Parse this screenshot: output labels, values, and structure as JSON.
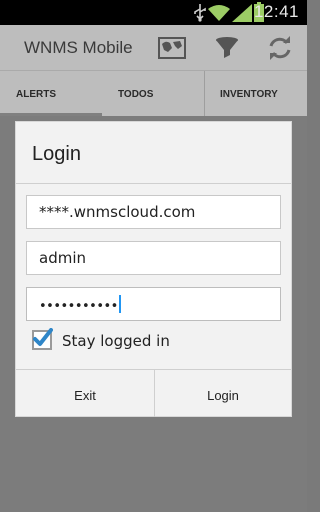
{
  "status_bar": {
    "time": "12:41",
    "icons": [
      "usb-icon",
      "wifi-icon",
      "signal-icon",
      "battery-icon"
    ]
  },
  "action_bar": {
    "title": "WNMS Mobile",
    "buttons": [
      "map-icon",
      "filter-icon",
      "refresh-icon"
    ]
  },
  "tabs": [
    {
      "label": "ALERTS",
      "selected": true
    },
    {
      "label": "TODOS",
      "selected": false
    },
    {
      "label": "INVENTORY",
      "selected": false
    }
  ],
  "login_dialog": {
    "title": "Login",
    "server_value": "****.wnmscloud.com",
    "username_value": "admin",
    "password_value": "•••••••••••",
    "stay_logged_in_label": "Stay logged in",
    "stay_logged_in_checked": true,
    "exit_label": "Exit",
    "login_label": "Login"
  },
  "colors": {
    "accent": "#1e88e5",
    "caret": "#2196f3",
    "checkmark": "#2f86c8"
  }
}
